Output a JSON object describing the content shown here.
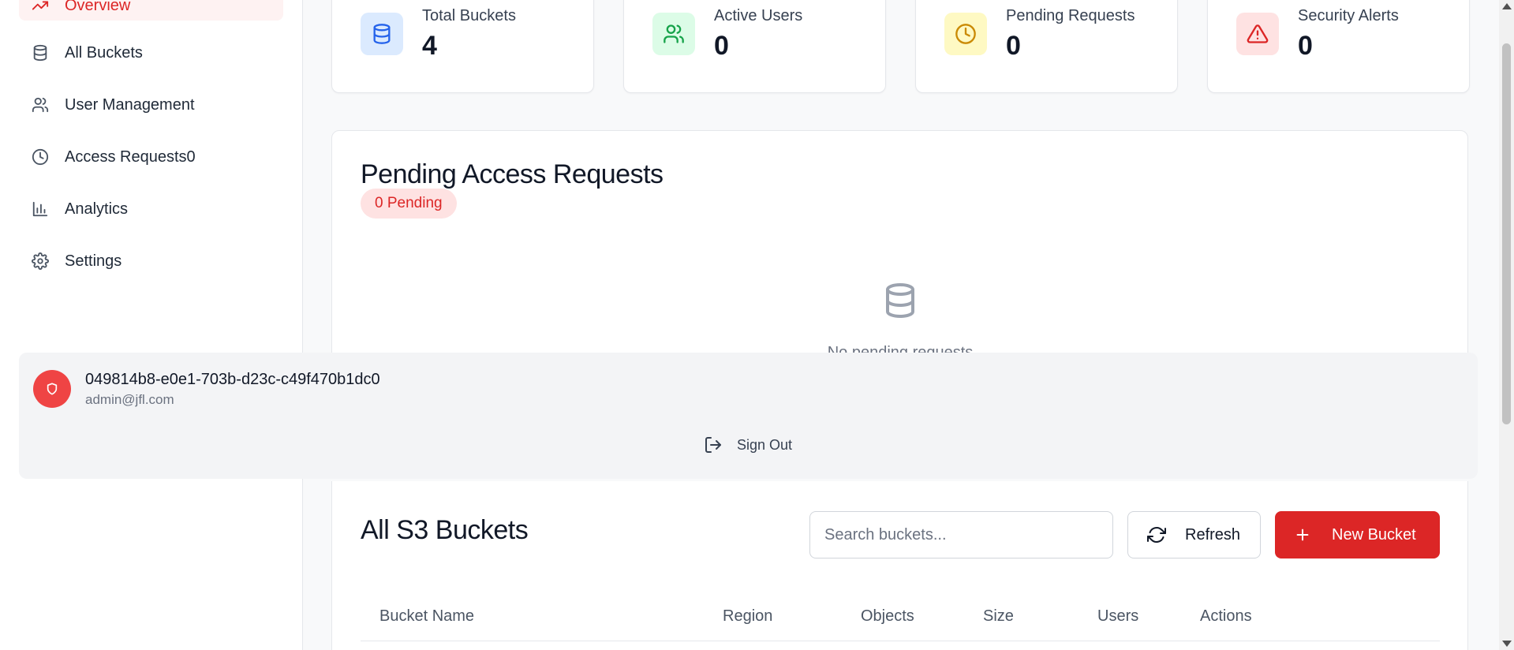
{
  "sidebar": {
    "active_item": {
      "label": "Overview",
      "icon": "trend-icon"
    },
    "items": [
      {
        "label": "All Buckets",
        "icon": "database-icon"
      },
      {
        "label": "User Management",
        "icon": "users-icon"
      },
      {
        "label": "Access Requests0",
        "icon": "clock-icon"
      },
      {
        "label": "Analytics",
        "icon": "bar-chart-icon"
      },
      {
        "label": "Settings",
        "icon": "gear-icon"
      }
    ]
  },
  "stats": [
    {
      "label": "Total Buckets",
      "value": "4",
      "icon": "database-icon",
      "color": "#2563eb",
      "bg": "#dbeafe"
    },
    {
      "label": "Active Users",
      "value": "0",
      "icon": "users-icon",
      "color": "#16a34a",
      "bg": "#dcfce7"
    },
    {
      "label": "Pending Requests",
      "value": "0",
      "icon": "clock-icon",
      "color": "#ca8a04",
      "bg": "#fef9c3"
    },
    {
      "label": "Security Alerts",
      "value": "0",
      "icon": "alert-triangle-icon",
      "color": "#dc2626",
      "bg": "#fee2e2"
    }
  ],
  "pending": {
    "title": "Pending Access Requests",
    "badge": "0 Pending",
    "empty_text": "No pending requests"
  },
  "user": {
    "id": "049814b8-e0e1-703b-d23c-c49f470b1dc0",
    "email": "admin@jfl.com",
    "sign_out": "Sign Out"
  },
  "buckets": {
    "title": "All S3 Buckets",
    "search_placeholder": "Search buckets...",
    "refresh_label": "Refresh",
    "new_label": "New Bucket",
    "columns": [
      "Bucket Name",
      "Region",
      "Objects",
      "Size",
      "Users",
      "Actions"
    ]
  },
  "colors": {
    "accent": "#dc2626",
    "accent_light": "#fef2f2"
  }
}
